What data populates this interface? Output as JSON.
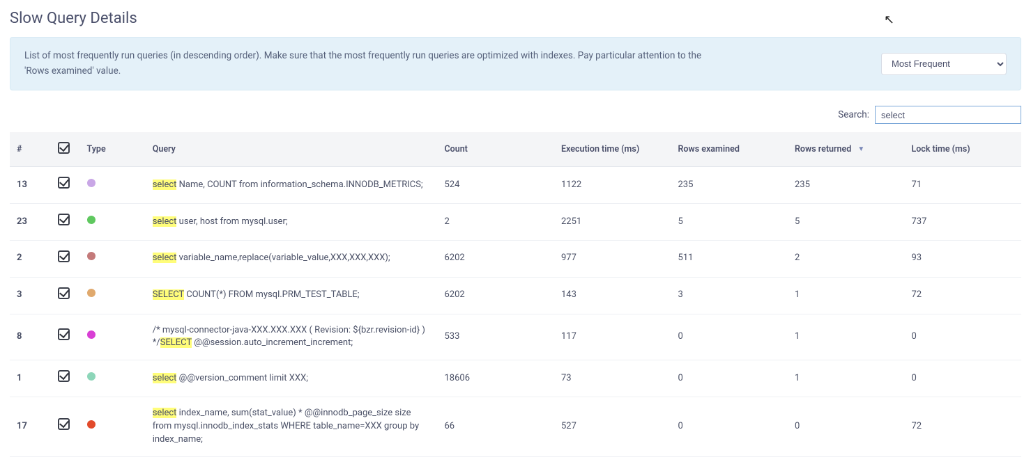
{
  "page": {
    "title": "Slow Query Details"
  },
  "banner": {
    "text": "List of most frequently run queries (in descending order). Make sure that the most frequently run queries are optimized with indexes. Pay particular attention to the 'Rows examined' value.",
    "sort_value": "Most Frequent"
  },
  "search": {
    "label": "Search:",
    "value": "select"
  },
  "highlight_term": "select",
  "columns": {
    "idx": "#",
    "type": "Type",
    "query": "Query",
    "count": "Count",
    "exec": "Execution time (ms)",
    "rows_ex": "Rows examined",
    "rows_ret": "Rows returned",
    "lock": "Lock time (ms)"
  },
  "dot_colors": [
    "#c9a7e6",
    "#5fc85f",
    "#c47a7a",
    "#e0a96d",
    "#d83fd4",
    "#8dd6b9",
    "#e24a2b"
  ],
  "rows": [
    {
      "idx": "13",
      "query": "select Name, COUNT from information_schema.INNODB_METRICS;",
      "count": "524",
      "exec": "1122",
      "rows_ex": "235",
      "rows_ret": "235",
      "lock": "71"
    },
    {
      "idx": "23",
      "query": "select user, host from mysql.user;",
      "count": "2",
      "exec": "2251",
      "rows_ex": "5",
      "rows_ret": "5",
      "lock": "737"
    },
    {
      "idx": "2",
      "query": "select variable_name,replace(variable_value,XXX,XXX,XXX);",
      "count": "6202",
      "exec": "977",
      "rows_ex": "511",
      "rows_ret": "2",
      "lock": "93"
    },
    {
      "idx": "3",
      "query": "SELECT COUNT(*) FROM mysql.PRM_TEST_TABLE;",
      "count": "6202",
      "exec": "143",
      "rows_ex": "3",
      "rows_ret": "1",
      "lock": "72"
    },
    {
      "idx": "8",
      "query": "/* mysql-connector-java-XXX.XXX.XXX ( Revision: ${bzr.revision-id} ) */SELECT @@session.auto_increment_increment;",
      "count": "533",
      "exec": "117",
      "rows_ex": "0",
      "rows_ret": "1",
      "lock": "0"
    },
    {
      "idx": "1",
      "query": "select @@version_comment limit XXX;",
      "count": "18606",
      "exec": "73",
      "rows_ex": "0",
      "rows_ret": "1",
      "lock": "0"
    },
    {
      "idx": "17",
      "query": "select index_name, sum(stat_value) * @@innodb_page_size size from mysql.innodb_index_stats WHERE table_name=XXX group by index_name;",
      "count": "66",
      "exec": "527",
      "rows_ex": "0",
      "rows_ret": "0",
      "lock": "72"
    }
  ]
}
